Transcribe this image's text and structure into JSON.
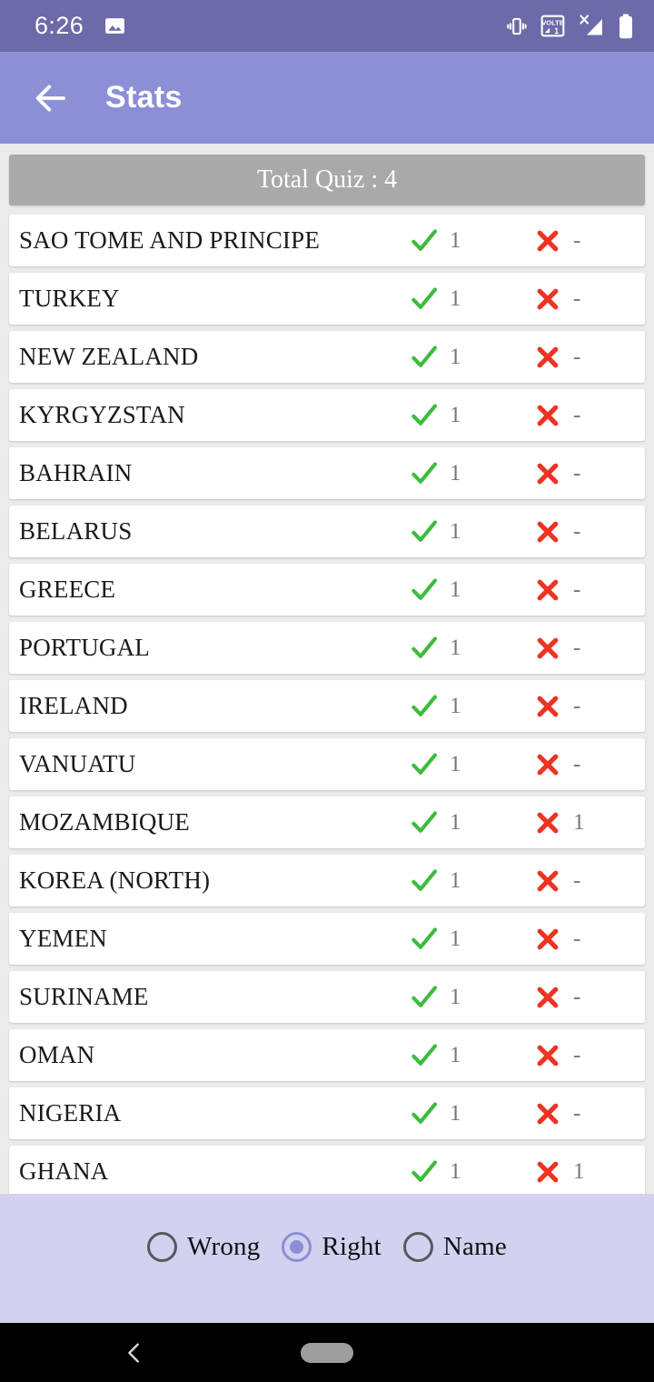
{
  "status_bar": {
    "time": "6:26",
    "icons": [
      "image-icon",
      "vibrate-icon",
      "volte-icon",
      "no-sim-signal-icon",
      "battery-icon"
    ],
    "background": "#6C6AA8"
  },
  "app_bar": {
    "title": "Stats",
    "back_icon": "arrow-left-icon",
    "background": "#8B8FD6"
  },
  "header": {
    "total_quiz_label": "Total Quiz : 4",
    "background": "#A9A9A9"
  },
  "list": {
    "right_mark": "✓",
    "wrong_mark": "✗",
    "right_color": "#3DBB3D",
    "wrong_color": "#EE3322",
    "rows": [
      {
        "name": "SAO TOME AND PRINCIPE",
        "right": "1",
        "wrong": "-"
      },
      {
        "name": "TURKEY",
        "right": "1",
        "wrong": "-"
      },
      {
        "name": "NEW ZEALAND",
        "right": "1",
        "wrong": "-"
      },
      {
        "name": "KYRGYZSTAN",
        "right": "1",
        "wrong": "-"
      },
      {
        "name": "BAHRAIN",
        "right": "1",
        "wrong": "-"
      },
      {
        "name": "BELARUS",
        "right": "1",
        "wrong": "-"
      },
      {
        "name": "GREECE",
        "right": "1",
        "wrong": "-"
      },
      {
        "name": "PORTUGAL",
        "right": "1",
        "wrong": "-"
      },
      {
        "name": "IRELAND",
        "right": "1",
        "wrong": "-"
      },
      {
        "name": "VANUATU",
        "right": "1",
        "wrong": "-"
      },
      {
        "name": "MOZAMBIQUE",
        "right": "1",
        "wrong": "1"
      },
      {
        "name": "KOREA (NORTH)",
        "right": "1",
        "wrong": "-"
      },
      {
        "name": "YEMEN",
        "right": "1",
        "wrong": "-"
      },
      {
        "name": "SURINAME",
        "right": "1",
        "wrong": "-"
      },
      {
        "name": "OMAN",
        "right": "1",
        "wrong": "-"
      },
      {
        "name": "NIGERIA",
        "right": "1",
        "wrong": "-"
      },
      {
        "name": "GHANA",
        "right": "1",
        "wrong": "1"
      }
    ]
  },
  "sort_options": {
    "background": "#D2D2F0",
    "selected": "Right",
    "options": [
      {
        "label": "Wrong",
        "selected": false
      },
      {
        "label": "Right",
        "selected": true
      },
      {
        "label": "Name",
        "selected": false
      }
    ]
  },
  "nav_bar": {
    "back_icon": "chevron-left-icon",
    "home_icon": "home-pill-icon",
    "background": "#000000"
  }
}
